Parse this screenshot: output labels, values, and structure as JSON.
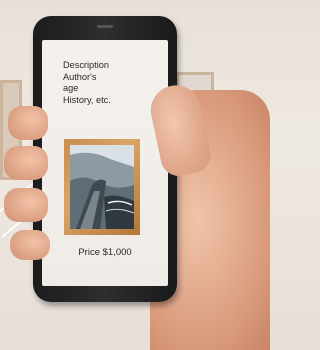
{
  "phone_screen": {
    "description_lines": [
      "Description",
      "Author's",
      "age",
      "History, etc."
    ],
    "price": "Price $1,000"
  }
}
